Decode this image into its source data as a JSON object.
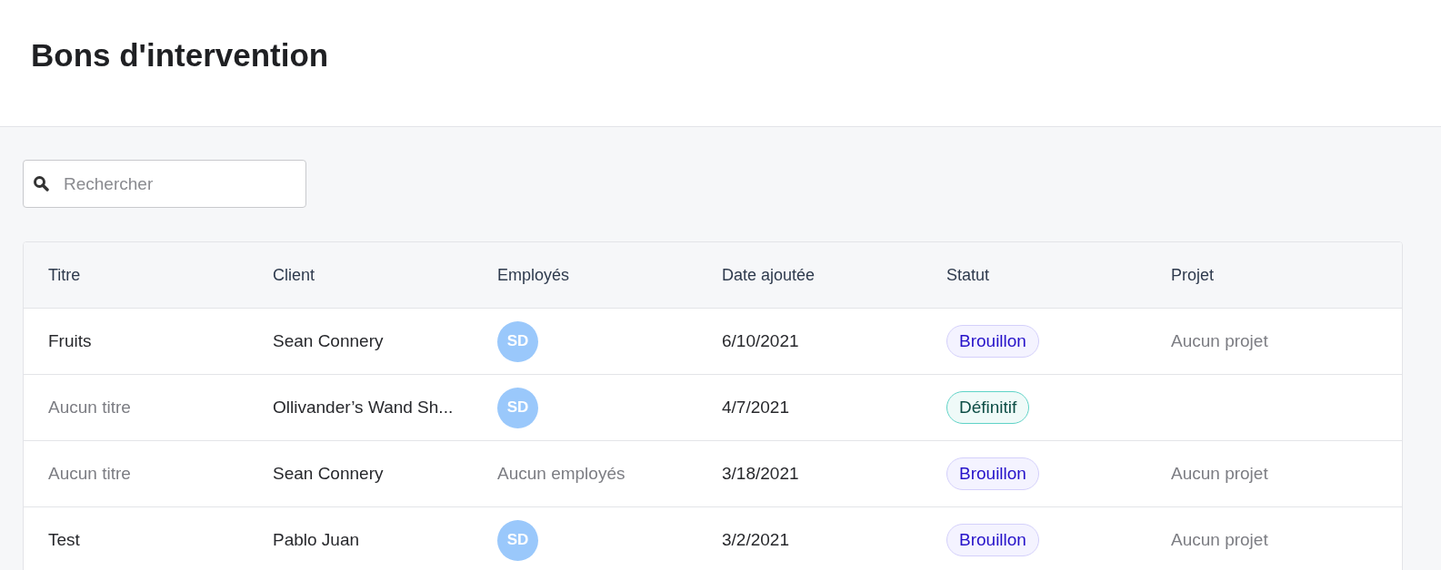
{
  "page": {
    "title": "Bons d'intervention"
  },
  "search": {
    "placeholder": "Rechercher"
  },
  "table": {
    "columns": [
      "Titre",
      "Client",
      "Employés",
      "Date ajoutée",
      "Statut",
      "Projet"
    ],
    "rows": [
      {
        "title": {
          "text": "Fruits",
          "muted": false
        },
        "client": "Sean Connery",
        "employees": {
          "kind": "avatar",
          "text": "SD"
        },
        "date": "6/10/2021",
        "status": {
          "kind": "draft",
          "label": "Brouillon"
        },
        "project": {
          "text": "Aucun projet",
          "muted": true
        }
      },
      {
        "title": {
          "text": "Aucun titre",
          "muted": true
        },
        "client": "Ollivander’s Wand Sh...",
        "employees": {
          "kind": "avatar",
          "text": "SD"
        },
        "date": "4/7/2021",
        "status": {
          "kind": "final",
          "label": "Définitif"
        }
      },
      {
        "title": {
          "text": "Aucun titre",
          "muted": true
        },
        "client": "Sean Connery",
        "employees": {
          "kind": "none",
          "text": "Aucun employés"
        },
        "date": "3/18/2021",
        "status": {
          "kind": "draft",
          "label": "Brouillon"
        },
        "project": {
          "text": "Aucun projet",
          "muted": true
        }
      },
      {
        "title": {
          "text": "Test",
          "muted": false
        },
        "client": "Pablo Juan",
        "employees": {
          "kind": "avatar",
          "text": "SD"
        },
        "date": "3/2/2021",
        "status": {
          "kind": "draft",
          "label": "Brouillon"
        },
        "project": {
          "text": "Aucun projet",
          "muted": true
        }
      }
    ]
  }
}
